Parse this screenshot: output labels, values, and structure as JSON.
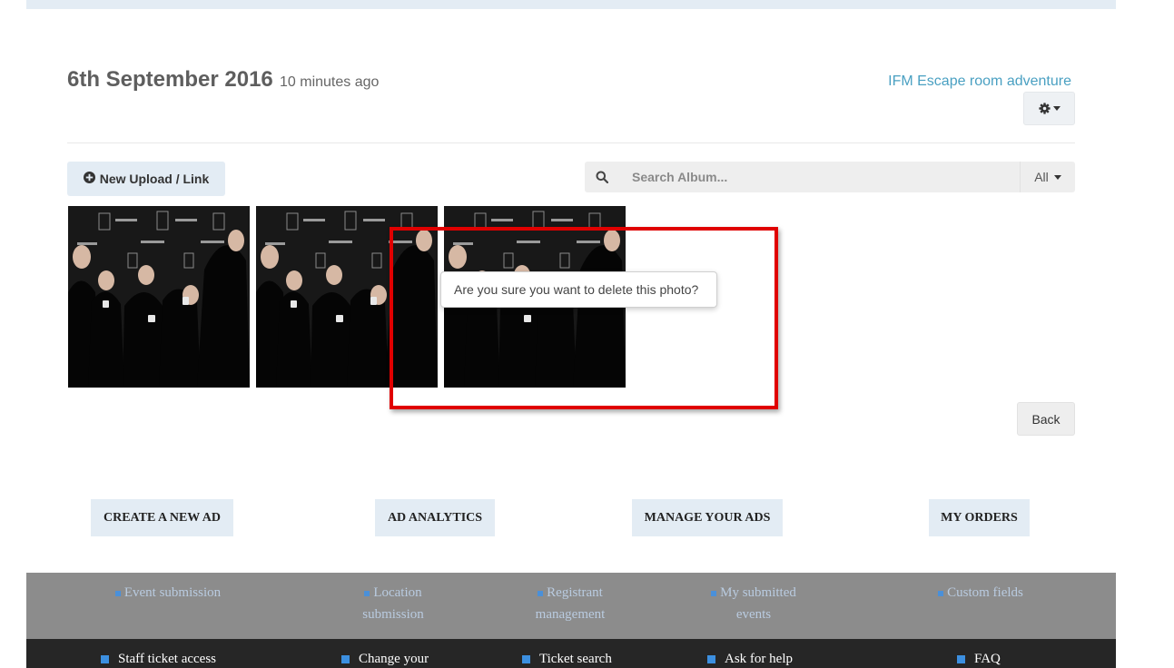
{
  "album": {
    "date": "6th September 2016",
    "ago": "10 minutes ago",
    "event_link": "IFM Escape room adventure"
  },
  "toolbar": {
    "upload_label": "New Upload / Link",
    "search_placeholder": "Search Album...",
    "filter_label": "All"
  },
  "photos": [
    {
      "icon": "photo-thumbnail"
    },
    {
      "icon": "photo-thumbnail"
    },
    {
      "icon": "photo-thumbnail"
    }
  ],
  "confirm": {
    "text": "Are you sure you want to delete this photo?"
  },
  "highlight_color": "#e00000",
  "back_label": "Back",
  "ad_buttons": [
    "CREATE A NEW AD",
    "AD ANALYTICS",
    "MANAGE YOUR ADS",
    "MY ORDERS"
  ],
  "footer_links": [
    {
      "lines": [
        "Event submission"
      ]
    },
    {
      "lines": [
        "Location",
        "submission"
      ]
    },
    {
      "lines": [
        "Registrant",
        "management"
      ]
    },
    {
      "lines": [
        "My submitted",
        "events"
      ]
    },
    {
      "lines": [
        "Custom fields"
      ]
    }
  ],
  "bottom_links": [
    "Staff ticket access",
    "Change your",
    "Ticket search",
    "Ask for help",
    "FAQ"
  ],
  "colors": {
    "link": "#4aa0c2",
    "button_bg": "#e3ecf4",
    "footer_gray": "#8c8c8c",
    "footer_dark": "#262626",
    "bullet_blue": "#3c8fe0"
  }
}
